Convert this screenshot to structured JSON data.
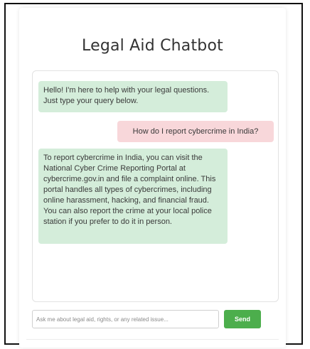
{
  "app": {
    "title": "Legal Aid Chatbot"
  },
  "chat": {
    "messages": [
      {
        "sender": "bot",
        "text": "Hello! I'm here to help with your legal questions. Just type your query below."
      },
      {
        "sender": "user",
        "text": "How do I report cybercrime in India?"
      },
      {
        "sender": "bot",
        "text": "To report cybercrime in India, you can visit the National Cyber Crime Reporting Portal at cybercrime.gov.in and file a complaint online. This portal handles all types of cybercrimes, including online harassment, hacking, and financial fraud. You can also report the crime at your local police station if you prefer to do it in person."
      }
    ]
  },
  "input": {
    "placeholder": "Ask me about legal aid, rights, or any related issue...",
    "value": ""
  },
  "send": {
    "label": "Send"
  },
  "colors": {
    "bot_bubble": "#d4edda",
    "user_bubble": "#f8d7da",
    "send_button": "#4cae4c"
  }
}
